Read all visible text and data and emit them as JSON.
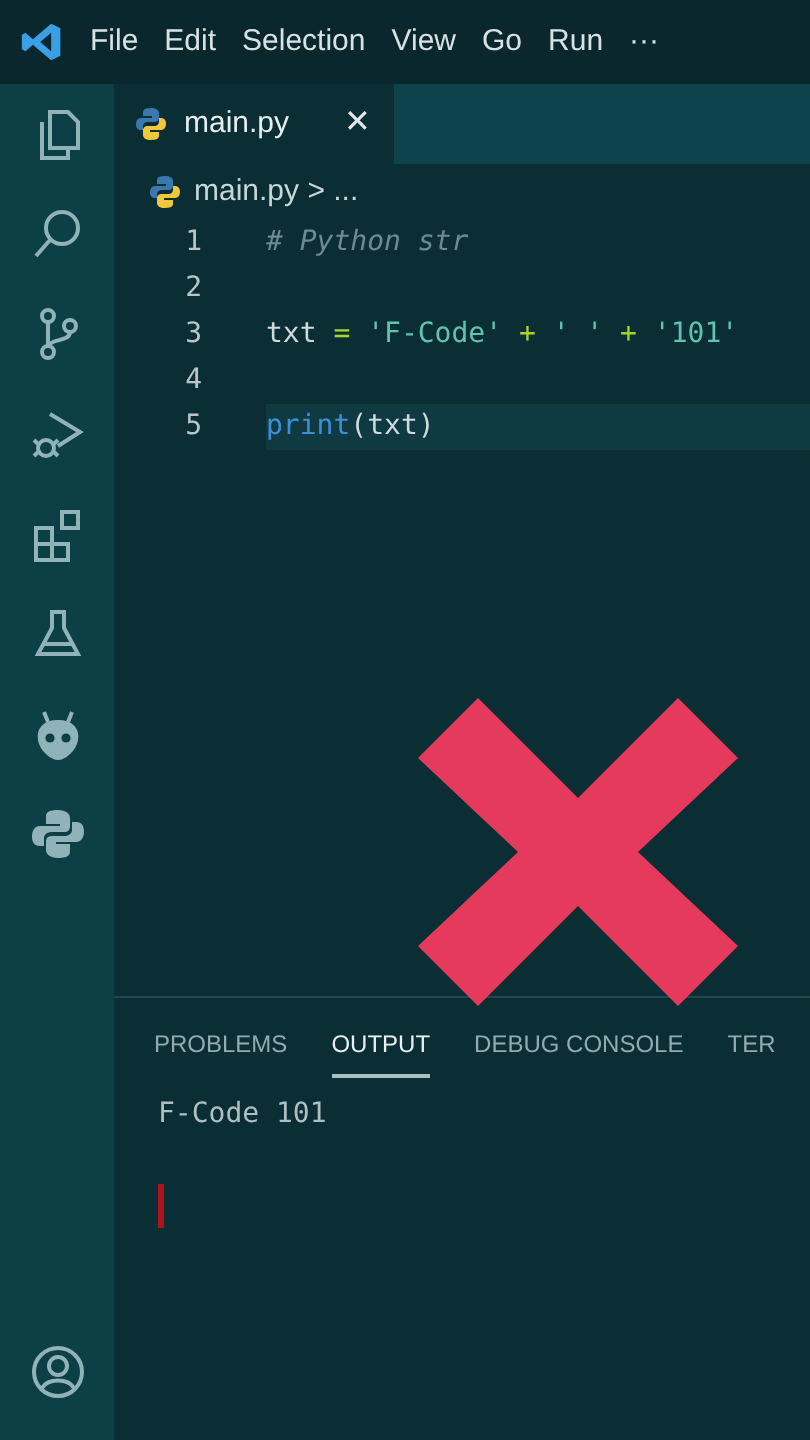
{
  "menu": [
    "File",
    "Edit",
    "Selection",
    "View",
    "Go",
    "Run",
    "···"
  ],
  "activity_bar": [
    {
      "kind": "files"
    },
    {
      "kind": "search"
    },
    {
      "kind": "source-control"
    },
    {
      "kind": "run-debug"
    },
    {
      "kind": "extensions"
    },
    {
      "kind": "testing"
    },
    {
      "kind": "platformio"
    },
    {
      "kind": "python"
    }
  ],
  "tabs": [
    {
      "label": "main.py",
      "close": "✕",
      "selected": true
    }
  ],
  "breadcrumb": {
    "file": "main.py",
    "rest": "> ..."
  },
  "code_lines": [
    {
      "number": "1",
      "highlighted": false,
      "tokens": [
        {
          "kind": "comment",
          "text": "# Python str"
        }
      ]
    },
    {
      "number": "2",
      "highlighted": false
    },
    {
      "number": "3",
      "highlighted": false,
      "tokens": [
        {
          "kind": "name",
          "text": "txt "
        },
        {
          "kind": "op",
          "text": "="
        },
        {
          "kind": "string",
          "text": " 'F-Code' "
        },
        {
          "kind": "op",
          "text": "+"
        },
        {
          "kind": "string",
          "text": " ' ' "
        },
        {
          "kind": "op",
          "text": "+"
        },
        {
          "kind": "string",
          "text": " '101'"
        }
      ]
    },
    {
      "number": "4",
      "highlighted": false
    },
    {
      "number": "5",
      "highlighted": true,
      "tokens": [
        {
          "kind": "func",
          "text": "print"
        },
        {
          "kind": "name",
          "text": "(txt)"
        }
      ]
    }
  ],
  "panel": {
    "tabs": [
      {
        "label": "PROBLEMS",
        "selected": false
      },
      {
        "label": "OUTPUT",
        "selected": true
      },
      {
        "label": "DEBUG CONSOLE",
        "selected": false
      },
      {
        "label": "TER",
        "selected": false
      }
    ],
    "output": [
      "F-Code 101"
    ]
  }
}
